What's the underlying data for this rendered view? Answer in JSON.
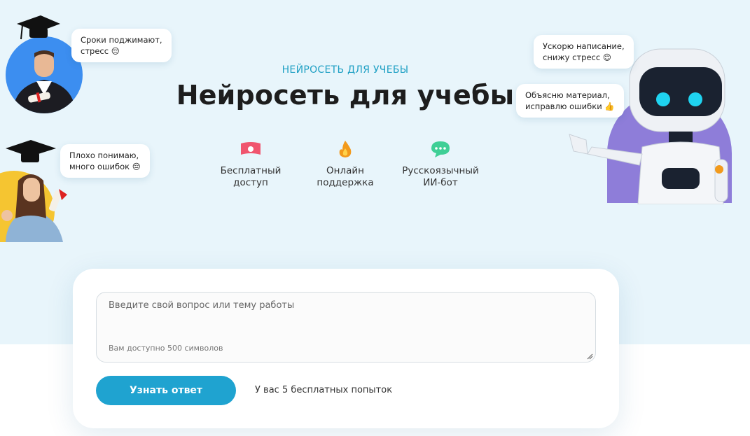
{
  "hero": {
    "subtitle": "НЕЙРОСЕТЬ ДЛЯ УЧЕБЫ",
    "title": "Нейросеть для учебы",
    "features": [
      {
        "icon": "money-icon",
        "line1": "Бесплатный",
        "line2": "доступ"
      },
      {
        "icon": "fire-icon",
        "line1": "Онлайн",
        "line2": "поддержка"
      },
      {
        "icon": "chat-bubble-icon",
        "line1": "Русскоязычный",
        "line2": "ИИ-бот"
      }
    ]
  },
  "bubbles": {
    "student1": {
      "line1": "Сроки поджимают,",
      "line2": "стресс 😔"
    },
    "student2": {
      "line1": "Плохо понимаю,",
      "line2": "много ошибок 😔"
    },
    "robot1": {
      "line1": "Ускорю написание,",
      "line2": "снижу стресс 😌"
    },
    "robot2": {
      "line1": "Объясню материал,",
      "line2": "исправлю ошибки 👍"
    }
  },
  "form": {
    "placeholder": "Введите свой вопрос или тему работы",
    "counter": "Вам доступно 500 символов",
    "submit_label": "Узнать ответ",
    "attempts_text": "У вас 5 бесплатных попыток"
  },
  "colors": {
    "accent": "#1fa3d0",
    "hero_bg": "#e8f5fb",
    "student1_circle": "#3c8ef0",
    "student2_circle": "#f5c531",
    "robot_bg": "#8e7dd9"
  }
}
